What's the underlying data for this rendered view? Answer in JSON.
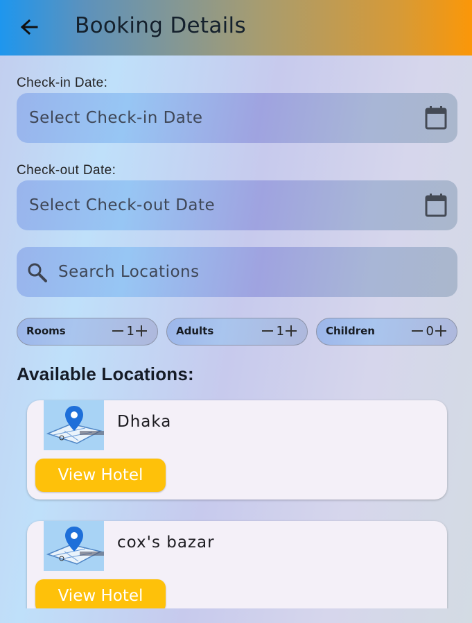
{
  "header": {
    "title": "Booking Details",
    "back_icon": "arrow-left-icon"
  },
  "checkin": {
    "label": "Check-in Date:",
    "placeholder": "Select Check-in Date",
    "icon": "calendar-icon"
  },
  "checkout": {
    "label": "Check-out Date:",
    "placeholder": "Select Check-out Date",
    "icon": "calendar-icon"
  },
  "search": {
    "placeholder": "Search Locations",
    "icon": "search-icon"
  },
  "counters": [
    {
      "label": "Rooms",
      "value": "1"
    },
    {
      "label": "Adults",
      "value": "1"
    },
    {
      "label": "Children",
      "value": "0"
    }
  ],
  "locations": {
    "title": "Available Locations:",
    "items": [
      {
        "name": "Dhaka",
        "button": "View Hotel",
        "image_icon": "map-pin-icon"
      },
      {
        "name": "cox's bazar",
        "button": "View Hotel",
        "image_icon": "map-pin-icon"
      }
    ]
  },
  "colors": {
    "appbar_start": "#1e96ee",
    "appbar_end": "#fb9708",
    "button": "#fec10a",
    "card": "#f4f0f8"
  }
}
